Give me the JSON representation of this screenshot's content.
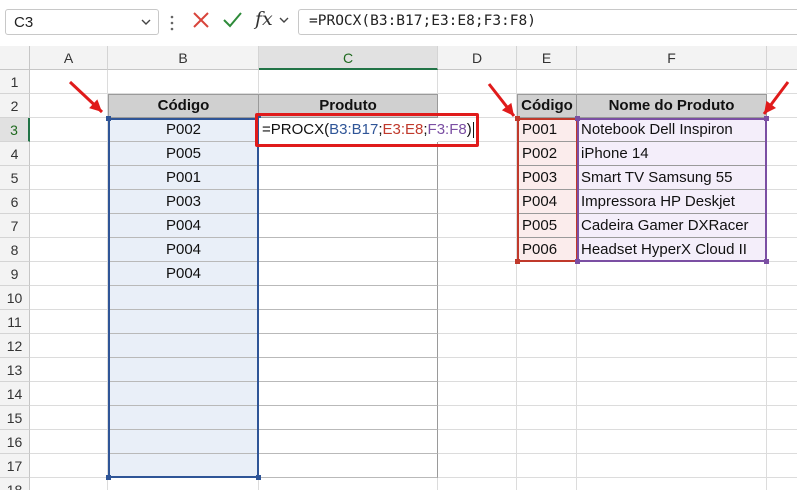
{
  "name_box": {
    "value": "C3"
  },
  "formula_bar": {
    "formula": "=PROCX(B3:B17;E3:E8;F3:F8)",
    "fx_label": "fx"
  },
  "columns": [
    "A",
    "B",
    "C",
    "D",
    "E",
    "F"
  ],
  "rows": [
    "1",
    "2",
    "3",
    "4",
    "5",
    "6",
    "7",
    "8",
    "9",
    "10",
    "11",
    "12",
    "13",
    "14",
    "15",
    "16",
    "17",
    "18"
  ],
  "table1": {
    "headers": {
      "codigo": "Código",
      "produto": "Produto"
    },
    "codigos": [
      "P002",
      "P005",
      "P001",
      "P003",
      "P004",
      "P004",
      "P004"
    ]
  },
  "editing_cell": {
    "prefix": "=PROCX(",
    "ref1": "B3:B17",
    "sep1": ";",
    "ref2": "E3:E8",
    "sep2": ";",
    "ref3": "F3:F8",
    "suffix": ")"
  },
  "table2": {
    "headers": {
      "codigo": "Código",
      "nome": "Nome do Produto"
    },
    "rows": [
      {
        "codigo": "P001",
        "nome": "Notebook Dell Inspiron"
      },
      {
        "codigo": "P002",
        "nome": "iPhone 14"
      },
      {
        "codigo": "P003",
        "nome": "Smart TV Samsung 55"
      },
      {
        "codigo": "P004",
        "nome": "Impressora HP Deskjet"
      },
      {
        "codigo": "P005",
        "nome": "Cadeira Gamer DXRacer"
      },
      {
        "codigo": "P006",
        "nome": "Headset HyperX Cloud II"
      }
    ]
  },
  "colors": {
    "ref1": "#2f5597",
    "ref2": "#c0392b",
    "ref3": "#7b4fa3",
    "header_fill": "#d0d0d0",
    "range_b_fill": "#e9eff8",
    "range_e_fill": "#fbecec",
    "range_f_fill": "#f4eefa",
    "annotation_red": "#e01b1b",
    "excel_green": "#217346"
  }
}
